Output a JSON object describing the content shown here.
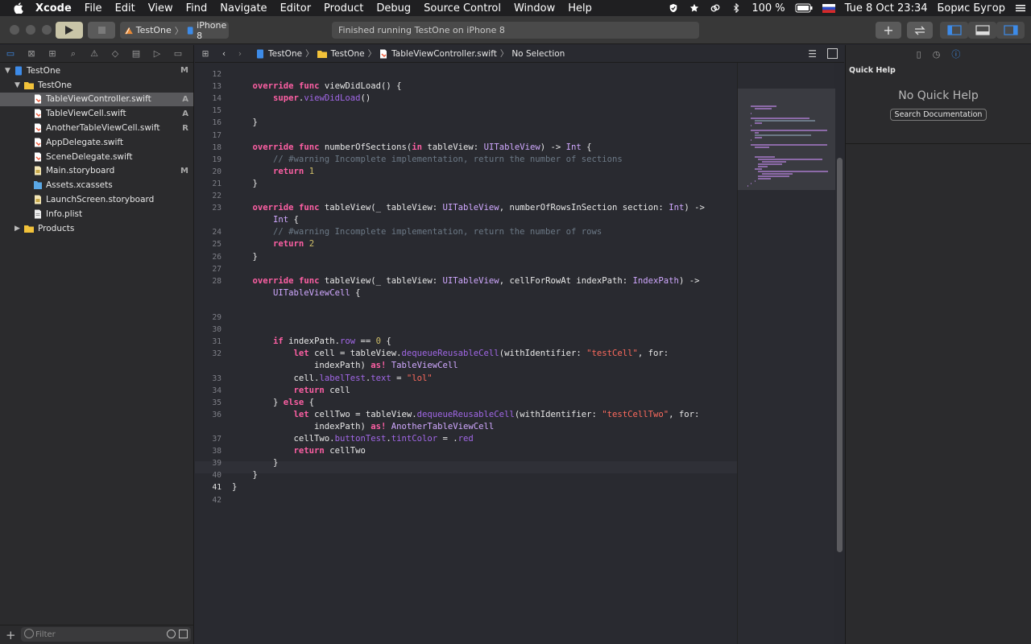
{
  "menubar": {
    "app": "Xcode",
    "items": [
      "File",
      "Edit",
      "View",
      "Find",
      "Navigate",
      "Editor",
      "Product",
      "Debug",
      "Source Control",
      "Window",
      "Help"
    ],
    "battery": "100 %",
    "datetime": "Tue 8 Oct  23:34",
    "user": "Борис Бугор"
  },
  "toolbar": {
    "scheme": "TestOne",
    "destination": "iPhone 8",
    "status": "Finished running TestOne on iPhone 8"
  },
  "navigator": {
    "project": {
      "label": "TestOne",
      "flag": "M"
    },
    "group": {
      "label": "TestOne"
    },
    "files": [
      {
        "label": "TableViewController.swift",
        "flag": "A",
        "icon": "swift-file-icon",
        "selected": true
      },
      {
        "label": "TableViewCell.swift",
        "flag": "A",
        "icon": "swift-file-icon"
      },
      {
        "label": "AnotherTableViewCell.swift",
        "flag": "R",
        "icon": "swift-file-icon"
      },
      {
        "label": "AppDelegate.swift",
        "flag": "",
        "icon": "swift-file-icon"
      },
      {
        "label": "SceneDelegate.swift",
        "flag": "",
        "icon": "swift-file-icon"
      },
      {
        "label": "Main.storyboard",
        "flag": "M",
        "icon": "storyboard-icon"
      },
      {
        "label": "Assets.xcassets",
        "flag": "",
        "icon": "asset-catalog-icon"
      },
      {
        "label": "LaunchScreen.storyboard",
        "flag": "",
        "icon": "storyboard-icon"
      },
      {
        "label": "Info.plist",
        "flag": "",
        "icon": "plist-icon"
      }
    ],
    "products": {
      "label": "Products"
    },
    "filter_placeholder": "Filter"
  },
  "jumpbar": {
    "crumbs": [
      "TestOne",
      "TestOne",
      "TableViewController.swift",
      "No Selection"
    ]
  },
  "editor": {
    "current_line": 41,
    "lines": [
      {
        "n": "12",
        "t": ""
      },
      {
        "n": "13",
        "t": "    override func viewDidLoad() {"
      },
      {
        "n": "14",
        "t": "        super.viewDidLoad()"
      },
      {
        "n": "15",
        "t": ""
      },
      {
        "n": "16",
        "t": "    }"
      },
      {
        "n": "17",
        "t": ""
      },
      {
        "n": "18",
        "t": "    override func numberOfSections(in tableView: UITableView) -> Int {"
      },
      {
        "n": "19",
        "t": "        // #warning Incomplete implementation, return the number of sections"
      },
      {
        "n": "20",
        "t": "        return 1"
      },
      {
        "n": "21",
        "t": "    }"
      },
      {
        "n": "22",
        "t": ""
      },
      {
        "n": "23",
        "t": "    override func tableView(_ tableView: UITableView, numberOfRowsInSection section: Int) ->"
      },
      {
        "n": "",
        "t": "        Int {"
      },
      {
        "n": "24",
        "t": "        // #warning Incomplete implementation, return the number of rows"
      },
      {
        "n": "25",
        "t": "        return 2"
      },
      {
        "n": "26",
        "t": "    }"
      },
      {
        "n": "27",
        "t": ""
      },
      {
        "n": "28",
        "t": "    override func tableView(_ tableView: UITableView, cellForRowAt indexPath: IndexPath) ->"
      },
      {
        "n": "",
        "t": "        UITableViewCell {"
      },
      {
        "n": "",
        "t": ""
      },
      {
        "n": "29",
        "t": ""
      },
      {
        "n": "30",
        "t": ""
      },
      {
        "n": "31",
        "t": "        if indexPath.row == 0 {"
      },
      {
        "n": "32",
        "t": "            let cell = tableView.dequeueReusableCell(withIdentifier: \"testCell\", for:"
      },
      {
        "n": "",
        "t": "                indexPath) as! TableViewCell"
      },
      {
        "n": "33",
        "t": "            cell.labelTest.text = \"lol\""
      },
      {
        "n": "34",
        "t": "            return cell"
      },
      {
        "n": "35",
        "t": "        } else {"
      },
      {
        "n": "36",
        "t": "            let cellTwo = tableView.dequeueReusableCell(withIdentifier: \"testCellTwo\", for:"
      },
      {
        "n": "",
        "t": "                indexPath) as! AnotherTableViewCell"
      },
      {
        "n": "37",
        "t": "            cellTwo.buttonTest.tintColor = .red"
      },
      {
        "n": "38",
        "t": "            return cellTwo"
      },
      {
        "n": "39",
        "t": "        }"
      },
      {
        "n": "40",
        "t": "    }"
      },
      {
        "n": "41",
        "t": "}"
      },
      {
        "n": "42",
        "t": ""
      }
    ]
  },
  "inspector": {
    "title": "Quick Help",
    "empty": "No Quick Help",
    "button": "Search Documentation"
  },
  "colors": {
    "keyword": "#fc5fa3",
    "type": "#d0a8ff",
    "function": "#67b7a4",
    "comment": "#6c7986",
    "number": "#d0bf69",
    "string": "#fc6a5d"
  }
}
